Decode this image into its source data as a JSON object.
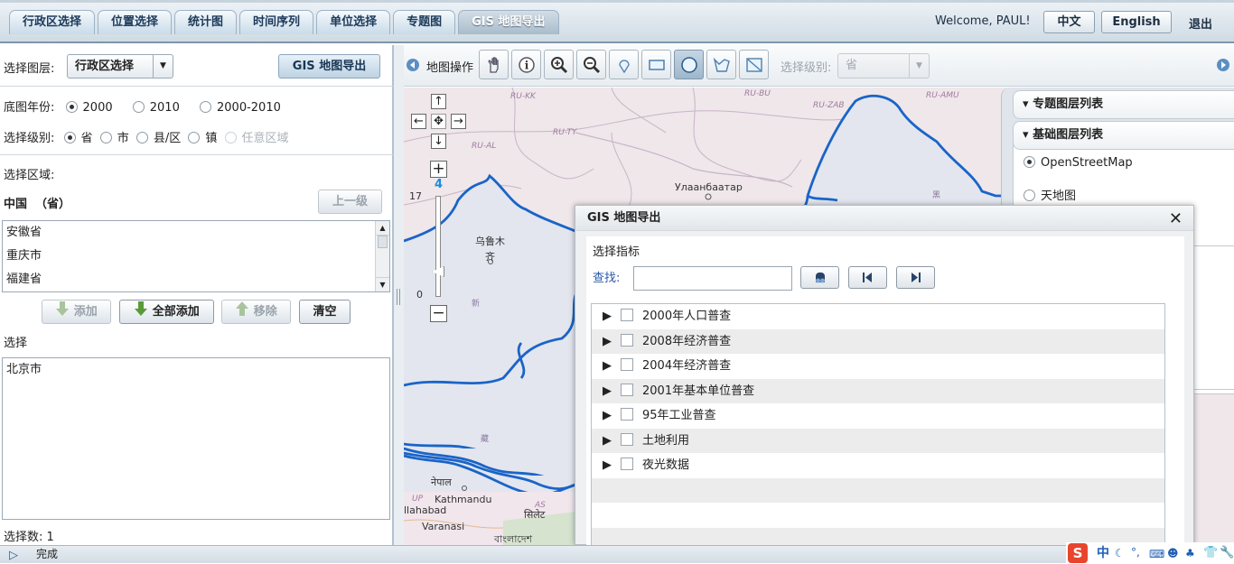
{
  "tabs": [
    "行政区选择",
    "位置选择",
    "统计图",
    "时间序列",
    "单位选择",
    "专题图",
    "GIS 地图导出"
  ],
  "welcome": "Welcome, PAUL!",
  "lang_zh": "中文",
  "lang_en": "English",
  "logout": "退出",
  "left": {
    "layer_label": "选择图层:",
    "layer_value": "行政区选择",
    "gis_export": "GIS 地图导出",
    "year_label": "底图年份:",
    "years": [
      "2000",
      "2010",
      "2000-2010"
    ],
    "level_label": "选择级别:",
    "levels": [
      "省",
      "市",
      "县/区",
      "镇",
      "任意区域"
    ],
    "region_label": "选择区域:",
    "region_current": "中国  （省）",
    "up_level": "上一级",
    "regions": [
      "安徽省",
      "重庆市",
      "福建省"
    ],
    "add": "添加",
    "add_all": "全部添加",
    "remove": "移除",
    "clear": "清空",
    "selected_label": "选择",
    "selected": [
      "北京市"
    ],
    "count": "选择数: 1"
  },
  "toolbar": {
    "label": "地图操作",
    "level_label": "选择级别:",
    "level_value": "省"
  },
  "map": {
    "zoom_top": "17",
    "zoom_level": "4",
    "zoom_bottom": "0",
    "labels": [
      "RU-KK",
      "RU-BU",
      "RU-ZAB",
      "RU-AMU",
      "RU-TY",
      "RU-AL",
      "Улаанбаатар",
      "乌鲁木",
      "齐",
      "新",
      "藏",
      "नेपाल",
      "UP",
      "Kathmandu",
      "llahabad",
      "Varanasi",
      "सिलेट",
      "বাংলাদেশ",
      "AS",
      "黑"
    ]
  },
  "layers": {
    "thematic": "专题图层列表",
    "base": "基础图层列表",
    "osm": "OpenStreetMap",
    "tianditu": "天地图"
  },
  "dialog": {
    "title": "GIS 地图导出",
    "indicator": "选择指标",
    "search_label": "查找:",
    "search_value": "",
    "items": [
      "2000年人口普查",
      "2008年经济普查",
      "2004年经济普查",
      "2001年基本单位普查",
      "95年工业普查",
      "土地利用",
      "夜光数据"
    ]
  },
  "status": "完成",
  "tray": [
    "中"
  ]
}
